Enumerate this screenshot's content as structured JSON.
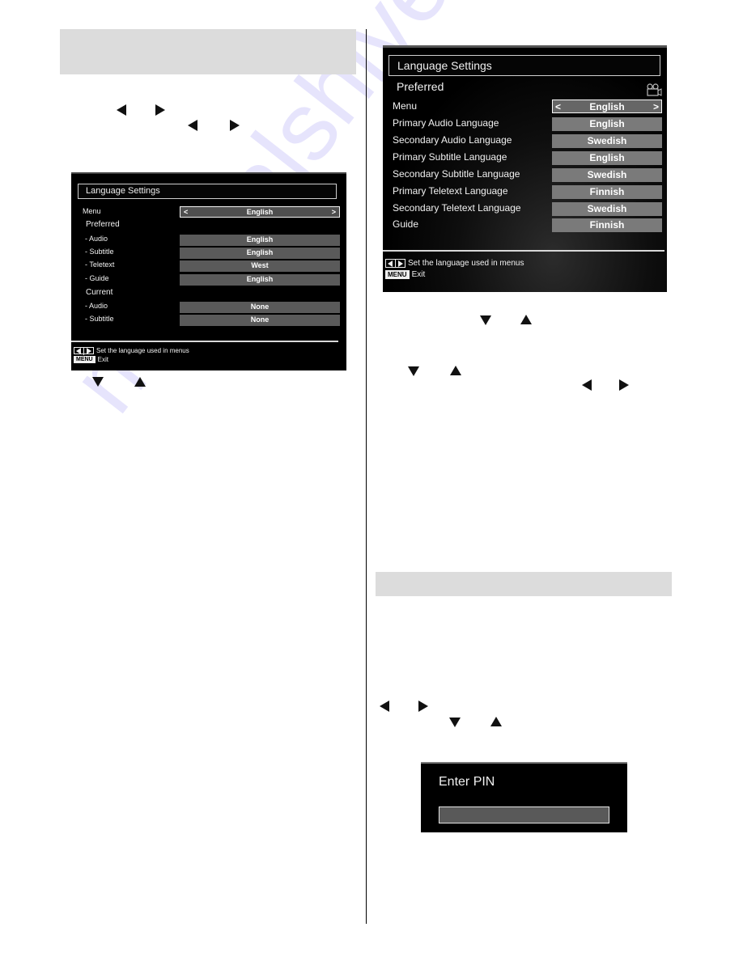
{
  "watermark": "manualshive.com",
  "left_osd": {
    "title": "Language Settings",
    "menu_label": "Menu",
    "menu_value": "English",
    "chevron_left": "<",
    "chevron_right": ">",
    "preferred_label": "Preferred",
    "preferred_rows": [
      {
        "label": "- Audio",
        "value": "English"
      },
      {
        "label": "- Subtitle",
        "value": "English"
      },
      {
        "label": "- Teletext",
        "value": "West"
      },
      {
        "label": "- Guide",
        "value": "English"
      }
    ],
    "current_label": "Current",
    "current_rows": [
      {
        "label": "- Audio",
        "value": "None"
      },
      {
        "label": "- Subtitle",
        "value": "None"
      }
    ],
    "footer": {
      "hint": "Set the language used in menus",
      "menu_key": "MENU",
      "exit": "Exit"
    }
  },
  "right_osd": {
    "title": "Language Settings",
    "subtitle": "Preferred",
    "chevron_left": "<",
    "chevron_right": ">",
    "rows": [
      {
        "label": "Menu",
        "value": "English",
        "selected": true
      },
      {
        "label": "Primary Audio Language",
        "value": "English"
      },
      {
        "label": "Secondary Audio Language",
        "value": "Swedish"
      },
      {
        "label": "Primary Subtitle Language",
        "value": "English"
      },
      {
        "label": "Secondary Subtitle Language",
        "value": "Swedish"
      },
      {
        "label": "Primary Teletext Language",
        "value": "Finnish"
      },
      {
        "label": "Secondary Teletext Language",
        "value": "Swedish"
      },
      {
        "label": "Guide",
        "value": "Finnish"
      }
    ],
    "footer": {
      "hint": "Set the language used in menus",
      "menu_key": "MENU",
      "exit": "Exit"
    }
  },
  "pin_dialog": {
    "title": "Enter PIN",
    "value": ""
  }
}
